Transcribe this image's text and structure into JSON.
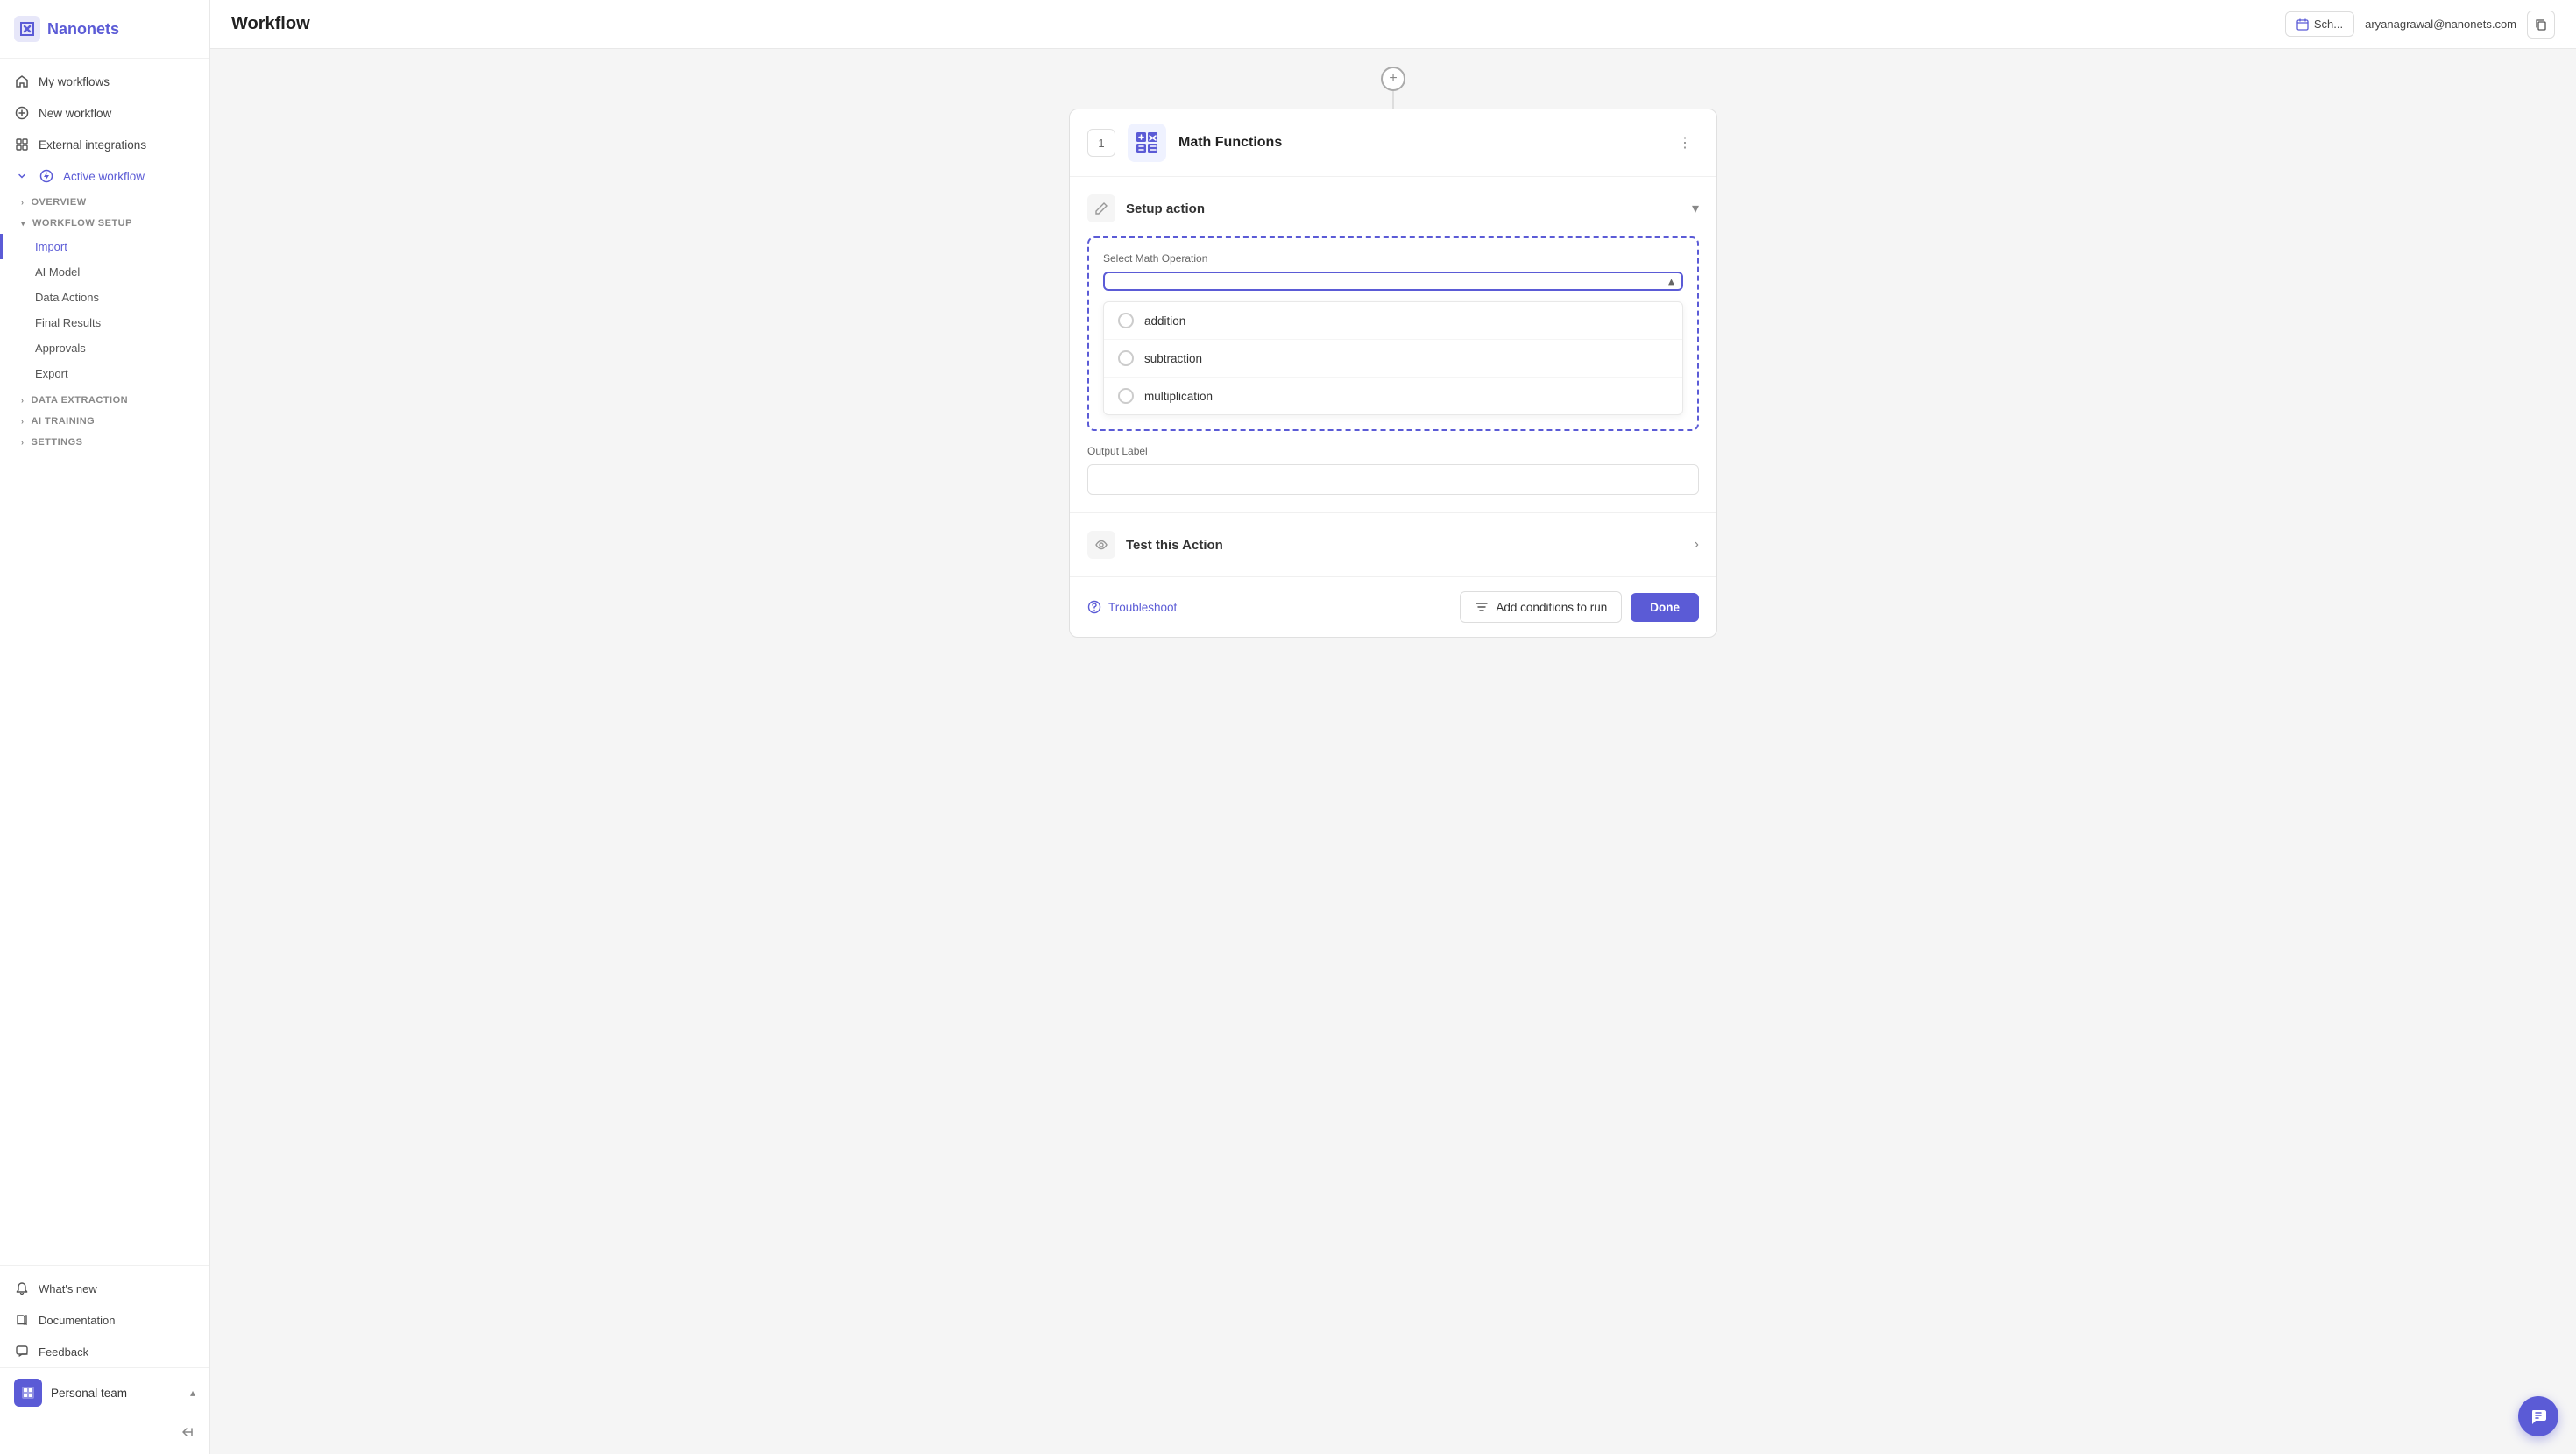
{
  "app": {
    "name": "Nanonets"
  },
  "header": {
    "title": "Workflow",
    "schedule_label": "Sch...",
    "user_email": "aryanagrawal@nanonets.com"
  },
  "sidebar": {
    "nav_items": [
      {
        "id": "my-workflows",
        "label": "My workflows",
        "icon": "home"
      },
      {
        "id": "new-workflow",
        "label": "New workflow",
        "icon": "plus-circle"
      },
      {
        "id": "external-integrations",
        "label": "External integrations",
        "icon": "grid"
      },
      {
        "id": "active-workflow",
        "label": "Active workflow",
        "icon": "zap",
        "active": true
      }
    ],
    "overview_label": "OVERVIEW",
    "workflow_setup": {
      "header": "WORKFLOW SETUP",
      "items": [
        {
          "id": "import",
          "label": "Import",
          "active": true
        },
        {
          "id": "ai-model",
          "label": "AI Model"
        },
        {
          "id": "data-actions",
          "label": "Data Actions"
        },
        {
          "id": "final-results",
          "label": "Final Results"
        },
        {
          "id": "approvals",
          "label": "Approvals"
        },
        {
          "id": "export",
          "label": "Export"
        }
      ]
    },
    "data_extraction": {
      "label": "DATA EXTRACTION"
    },
    "ai_training": {
      "label": "AI TRAINING"
    },
    "settings": {
      "label": "SETTINGS"
    },
    "whats_new": "What's new",
    "documentation": "Documentation",
    "feedback": "Feedback",
    "personal_team": "Personal team"
  },
  "workflow": {
    "step_number": "1",
    "step_title": "Math Functions",
    "setup_action": {
      "title": "Setup action",
      "math_operation_label": "Select Math Operation",
      "dropdown_placeholder": "",
      "options": [
        {
          "id": "addition",
          "label": "addition"
        },
        {
          "id": "subtraction",
          "label": "subtraction"
        },
        {
          "id": "multiplication",
          "label": "multiplication"
        }
      ],
      "output_label_text": "Output Label",
      "output_label_placeholder": ""
    },
    "test_action": {
      "title": "Test this Action"
    },
    "bottom_bar": {
      "troubleshoot": "Troubleshoot",
      "add_conditions": "Add conditions to run",
      "done": "Done"
    }
  },
  "icons": {
    "home": "🏠",
    "plus_circle": "⊕",
    "grid": "▦",
    "zap": "⚡",
    "chevron_down": "▾",
    "chevron_right": "›",
    "chevron_up": "▴",
    "dots": "⋮",
    "pencil": "✎",
    "eye": "◎",
    "gear": "⚙",
    "filter": "⊟",
    "chat": "💬"
  }
}
